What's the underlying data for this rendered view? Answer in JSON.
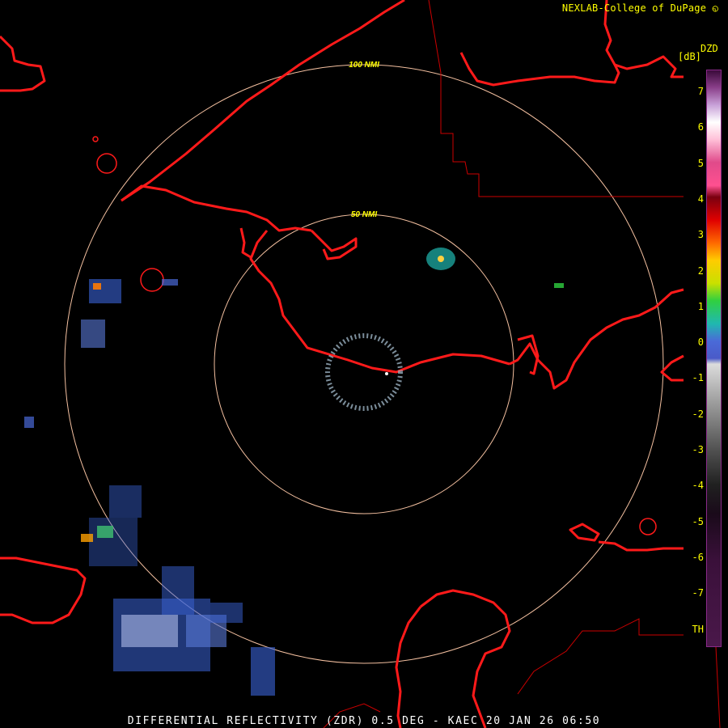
{
  "header": {
    "credit": "NEXLAB-College of DuPage"
  },
  "footer": {
    "caption": "DIFFERENTIAL REFLECTIVITY (ZDR) 0.5 DEG - KAEC 20 JAN 26 06:50"
  },
  "range_rings": [
    {
      "label": "50 NMI",
      "color": "#f4c0a0"
    },
    {
      "label": "100 NMI",
      "color": "#f4c0a0"
    }
  ],
  "colors": {
    "coastline": "#ff1a1a",
    "boundary": "#cc0000",
    "label": "#ffff00",
    "ring": "#f4c0a0"
  },
  "colorbar": {
    "product": "DZD",
    "unit": "[dB]",
    "ticks": [
      "7",
      "6",
      "5",
      "4",
      "3",
      "2",
      "1",
      "0",
      "-1",
      "-2",
      "-3",
      "-4",
      "-5",
      "-6",
      "-7",
      "TH"
    ]
  }
}
